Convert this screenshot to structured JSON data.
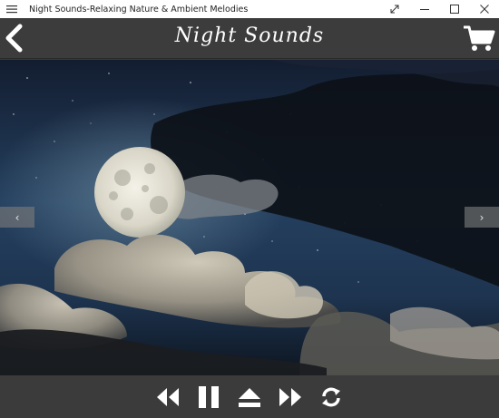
{
  "window": {
    "title": "Night Sounds-Relaxing Nature & Ambient Melodies",
    "icons": [
      "hamburger-icon",
      "expand-icon",
      "minimize-icon",
      "maximize-icon",
      "close-icon"
    ]
  },
  "app": {
    "title": "Night Sounds",
    "left_icon": "back-chevron-icon",
    "right_icon": "shopping-cart-icon"
  },
  "scene": {
    "prev_label": "‹",
    "next_label": "›",
    "image": "night-sky-with-full-moon-and-clouds"
  },
  "player": {
    "controls": [
      "rewind-icon",
      "pause-icon",
      "eject-icon",
      "fast-forward-icon",
      "repeat-icon"
    ]
  },
  "colors": {
    "bar": "#3c3c3c",
    "titlebar": "#ffffff",
    "sky_top": "#1a2a44",
    "sky_mid": "#2a4a6e",
    "moon": "#e8e6da"
  }
}
